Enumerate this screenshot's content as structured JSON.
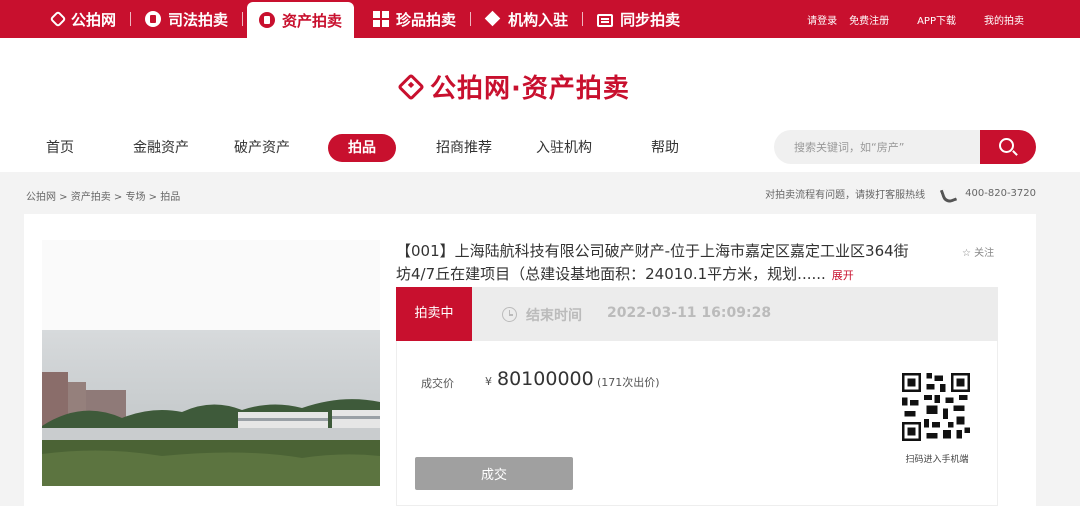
{
  "topbar": {
    "items": [
      {
        "label": "公拍网"
      },
      {
        "label": "司法拍卖"
      },
      {
        "label": "资产拍卖"
      },
      {
        "label": "珍品拍卖"
      },
      {
        "label": "机构入驻"
      },
      {
        "label": "同步拍卖"
      }
    ],
    "active_index": 2,
    "login": "请登录",
    "register": "免费注册",
    "app": "APP下载",
    "my_auction": "我的拍卖"
  },
  "brand": {
    "text": "公拍网·资产拍卖"
  },
  "mainnav": {
    "items": [
      {
        "label": "首页"
      },
      {
        "label": "金融资产"
      },
      {
        "label": "破产资产"
      },
      {
        "label": "拍品"
      },
      {
        "label": "招商推荐"
      },
      {
        "label": "入驻机构"
      },
      {
        "label": "帮助"
      }
    ],
    "active_index": 3
  },
  "search": {
    "placeholder": "搜索关键词，如“房产”"
  },
  "breadcrumb": {
    "text": "公拍网 > 资产拍卖 > 专场 > 拍品"
  },
  "hotline": {
    "text": "对拍卖流程有问题，请拨打客服热线",
    "number": "400-820-3720"
  },
  "lot": {
    "title": "【001】上海陆航科技有限公司破产财产-位于上海市嘉定区嘉定工业区364街坊4/7丘在建项目（总建设基地面积：24010.1平方米，规划......",
    "expand": "展开",
    "follow": "☆ 关注",
    "status": "拍卖中",
    "end_label": "结束时间",
    "end_time": "2022-03-11 16:09:28",
    "price_label": "成交价",
    "currency": "¥",
    "price": "80100000",
    "bids": "(171次出价)",
    "deal_button": "成交",
    "qr_caption": "扫码进入手机端"
  },
  "colors": {
    "brand_red": "#c8102e",
    "button_gray": "#a0a0a0"
  }
}
